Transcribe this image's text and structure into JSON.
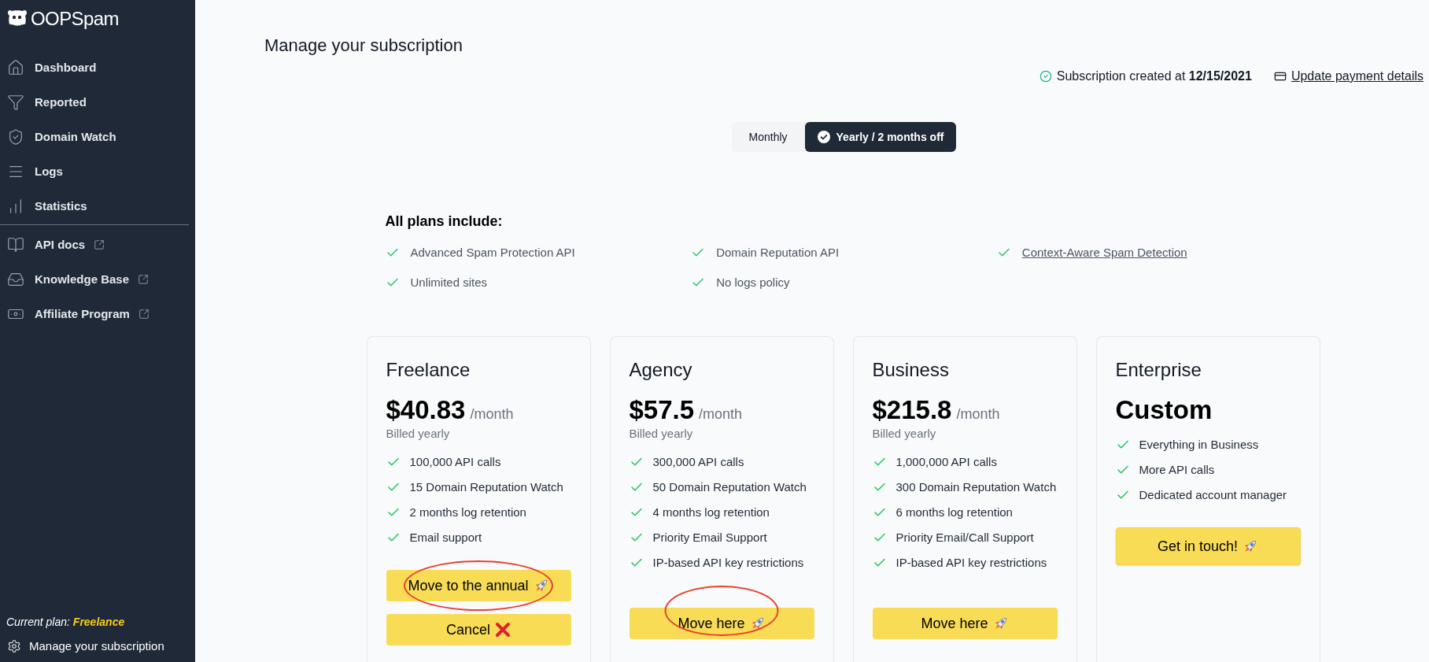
{
  "sidebar": {
    "logo": {
      "text": "OOPSpam"
    },
    "nav": [
      {
        "label": "Dashboard"
      },
      {
        "label": "Reported"
      },
      {
        "label": "Domain Watch"
      },
      {
        "label": "Logs"
      },
      {
        "label": "Statistics"
      }
    ],
    "links": [
      {
        "label": "API docs",
        "external": true
      },
      {
        "label": "Knowledge Base",
        "external": true
      },
      {
        "label": "Affiliate Program",
        "external": true
      }
    ],
    "current_plan": {
      "label": "Current plan:",
      "value": "Freelance"
    },
    "footer_link": {
      "label": "Manage your subscription"
    }
  },
  "page": {
    "title": "Manage your subscription",
    "subscription": {
      "label": "Subscription created at",
      "date": "12/15/2021"
    },
    "payment_link": {
      "label": "Update payment details"
    }
  },
  "billing_toggle": [
    {
      "label": "Monthly",
      "selected": false
    },
    {
      "label": "Yearly / 2 months off",
      "selected": true
    }
  ],
  "all_plans": {
    "heading": "All plans include:",
    "features": [
      {
        "label": "Advanced Spam Protection API",
        "link": false
      },
      {
        "label": "Domain Reputation API",
        "link": false
      },
      {
        "label": "Context-Aware Spam Detection",
        "link": true
      },
      {
        "label": "Unlimited sites",
        "link": false
      },
      {
        "label": "No logs policy",
        "link": false
      }
    ]
  },
  "plans": [
    {
      "name": "Freelance",
      "price": "$40.83",
      "period": "/month",
      "billing": "Billed yearly",
      "features": [
        "100,000 API calls",
        "15 Domain Reputation Watch",
        "2 months log retention",
        "Email support"
      ],
      "buttons": [
        {
          "label": "Move to the annual",
          "kind": "upgrade",
          "circled": true
        },
        {
          "label": "Cancel",
          "kind": "cancel",
          "circled": false
        }
      ]
    },
    {
      "name": "Agency",
      "price": "$57.5",
      "period": "/month",
      "billing": "Billed yearly",
      "features": [
        "300,000 API calls",
        "50 Domain Reputation Watch",
        "4 months log retention",
        "Priority Email Support",
        "IP-based API key restrictions"
      ],
      "buttons": [
        {
          "label": "Move here",
          "kind": "move",
          "circled": true
        }
      ]
    },
    {
      "name": "Business",
      "price": "$215.8",
      "period": "/month",
      "billing": "Billed yearly",
      "features": [
        "1,000,000 API calls",
        "300 Domain Reputation Watch",
        "6 months log retention",
        "Priority Email/Call Support",
        "IP-based API key restrictions"
      ],
      "buttons": [
        {
          "label": "Move here",
          "kind": "move",
          "circled": false
        }
      ]
    },
    {
      "name": "Enterprise",
      "price": "Custom",
      "features": [
        "Everything in Business",
        "More API calls",
        "Dedicated account manager"
      ],
      "buttons": [
        {
          "label": "Get in touch!",
          "kind": "contact",
          "circled": false
        }
      ]
    }
  ]
}
